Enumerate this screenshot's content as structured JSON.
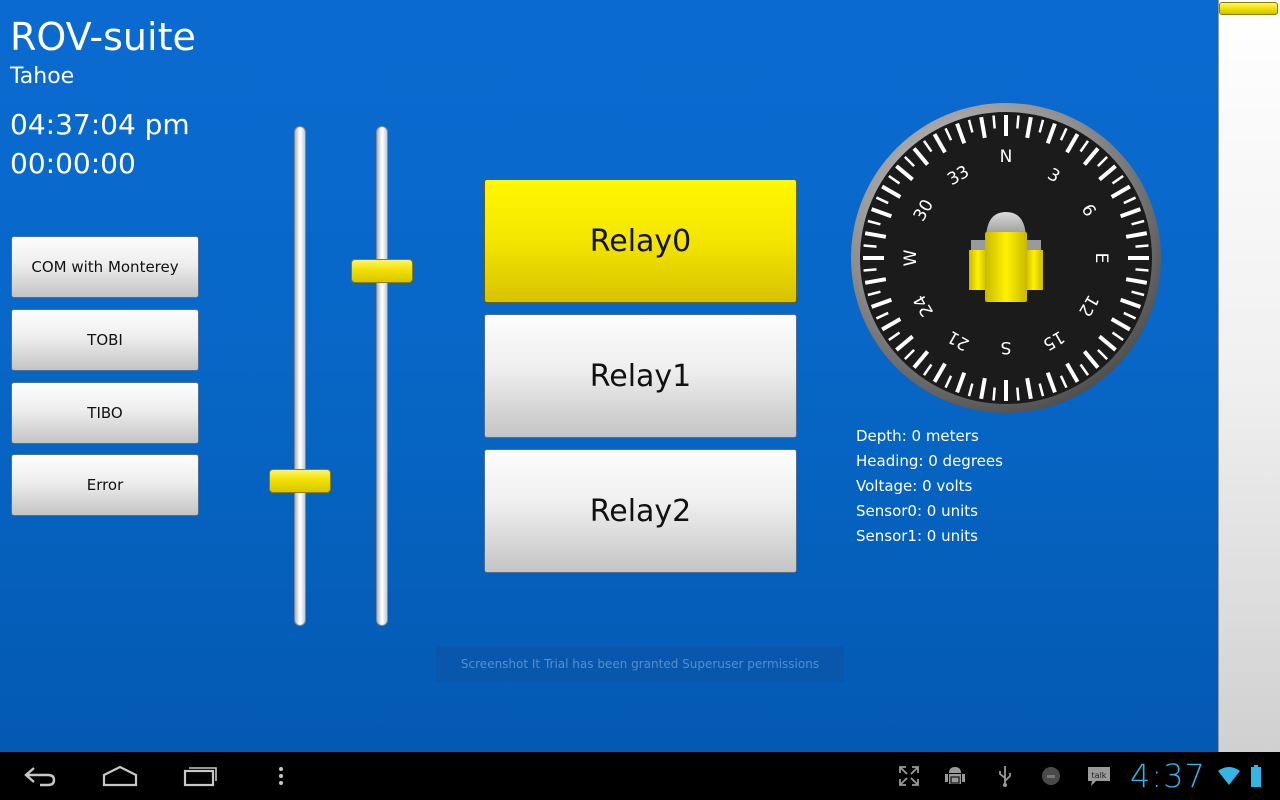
{
  "app": {
    "title": "ROV-suite",
    "subtitle": "Tahoe",
    "clock": "04:37:04 pm",
    "timer": "00:00:00"
  },
  "side_buttons": [
    {
      "label": "COM with Monterey"
    },
    {
      "label": "TOBI"
    },
    {
      "label": "TIBO"
    },
    {
      "label": "Error"
    }
  ],
  "sliders": [
    {
      "name": "left-throttle",
      "level": 0.28
    },
    {
      "name": "right-throttle",
      "level": 0.72
    }
  ],
  "relays": [
    {
      "label": "Relay0",
      "state": "on"
    },
    {
      "label": "Relay1",
      "state": "off"
    },
    {
      "label": "Relay2",
      "state": "off"
    }
  ],
  "compass": {
    "heading_deg": 0,
    "cardinals": [
      "N",
      "E",
      "S",
      "W"
    ],
    "numerals": [
      "3",
      "6",
      "12",
      "15",
      "21",
      "24",
      "30",
      "33"
    ]
  },
  "stats": {
    "depth": "Depth: 0 meters",
    "heading": "Heading: 0 degrees",
    "voltage": "Voltage: 0 volts",
    "sensor0": "Sensor0: 0 units",
    "sensor1": "Sensor1: 0 units"
  },
  "toast": "Screenshot It Trial has been granted Superuser permissions",
  "navbar": {
    "time": "4:37",
    "icons": [
      "back-icon",
      "home-icon",
      "recent-apps-icon",
      "menu-icon",
      "screen-compat-icon",
      "android-debug-icon",
      "usb-icon",
      "notification-dot-icon",
      "talk-icon",
      "wifi-icon",
      "battery-icon"
    ]
  },
  "colors": {
    "background": "#0868c9",
    "accent": "#f4e500",
    "nav_clock": "#33b5e5"
  }
}
